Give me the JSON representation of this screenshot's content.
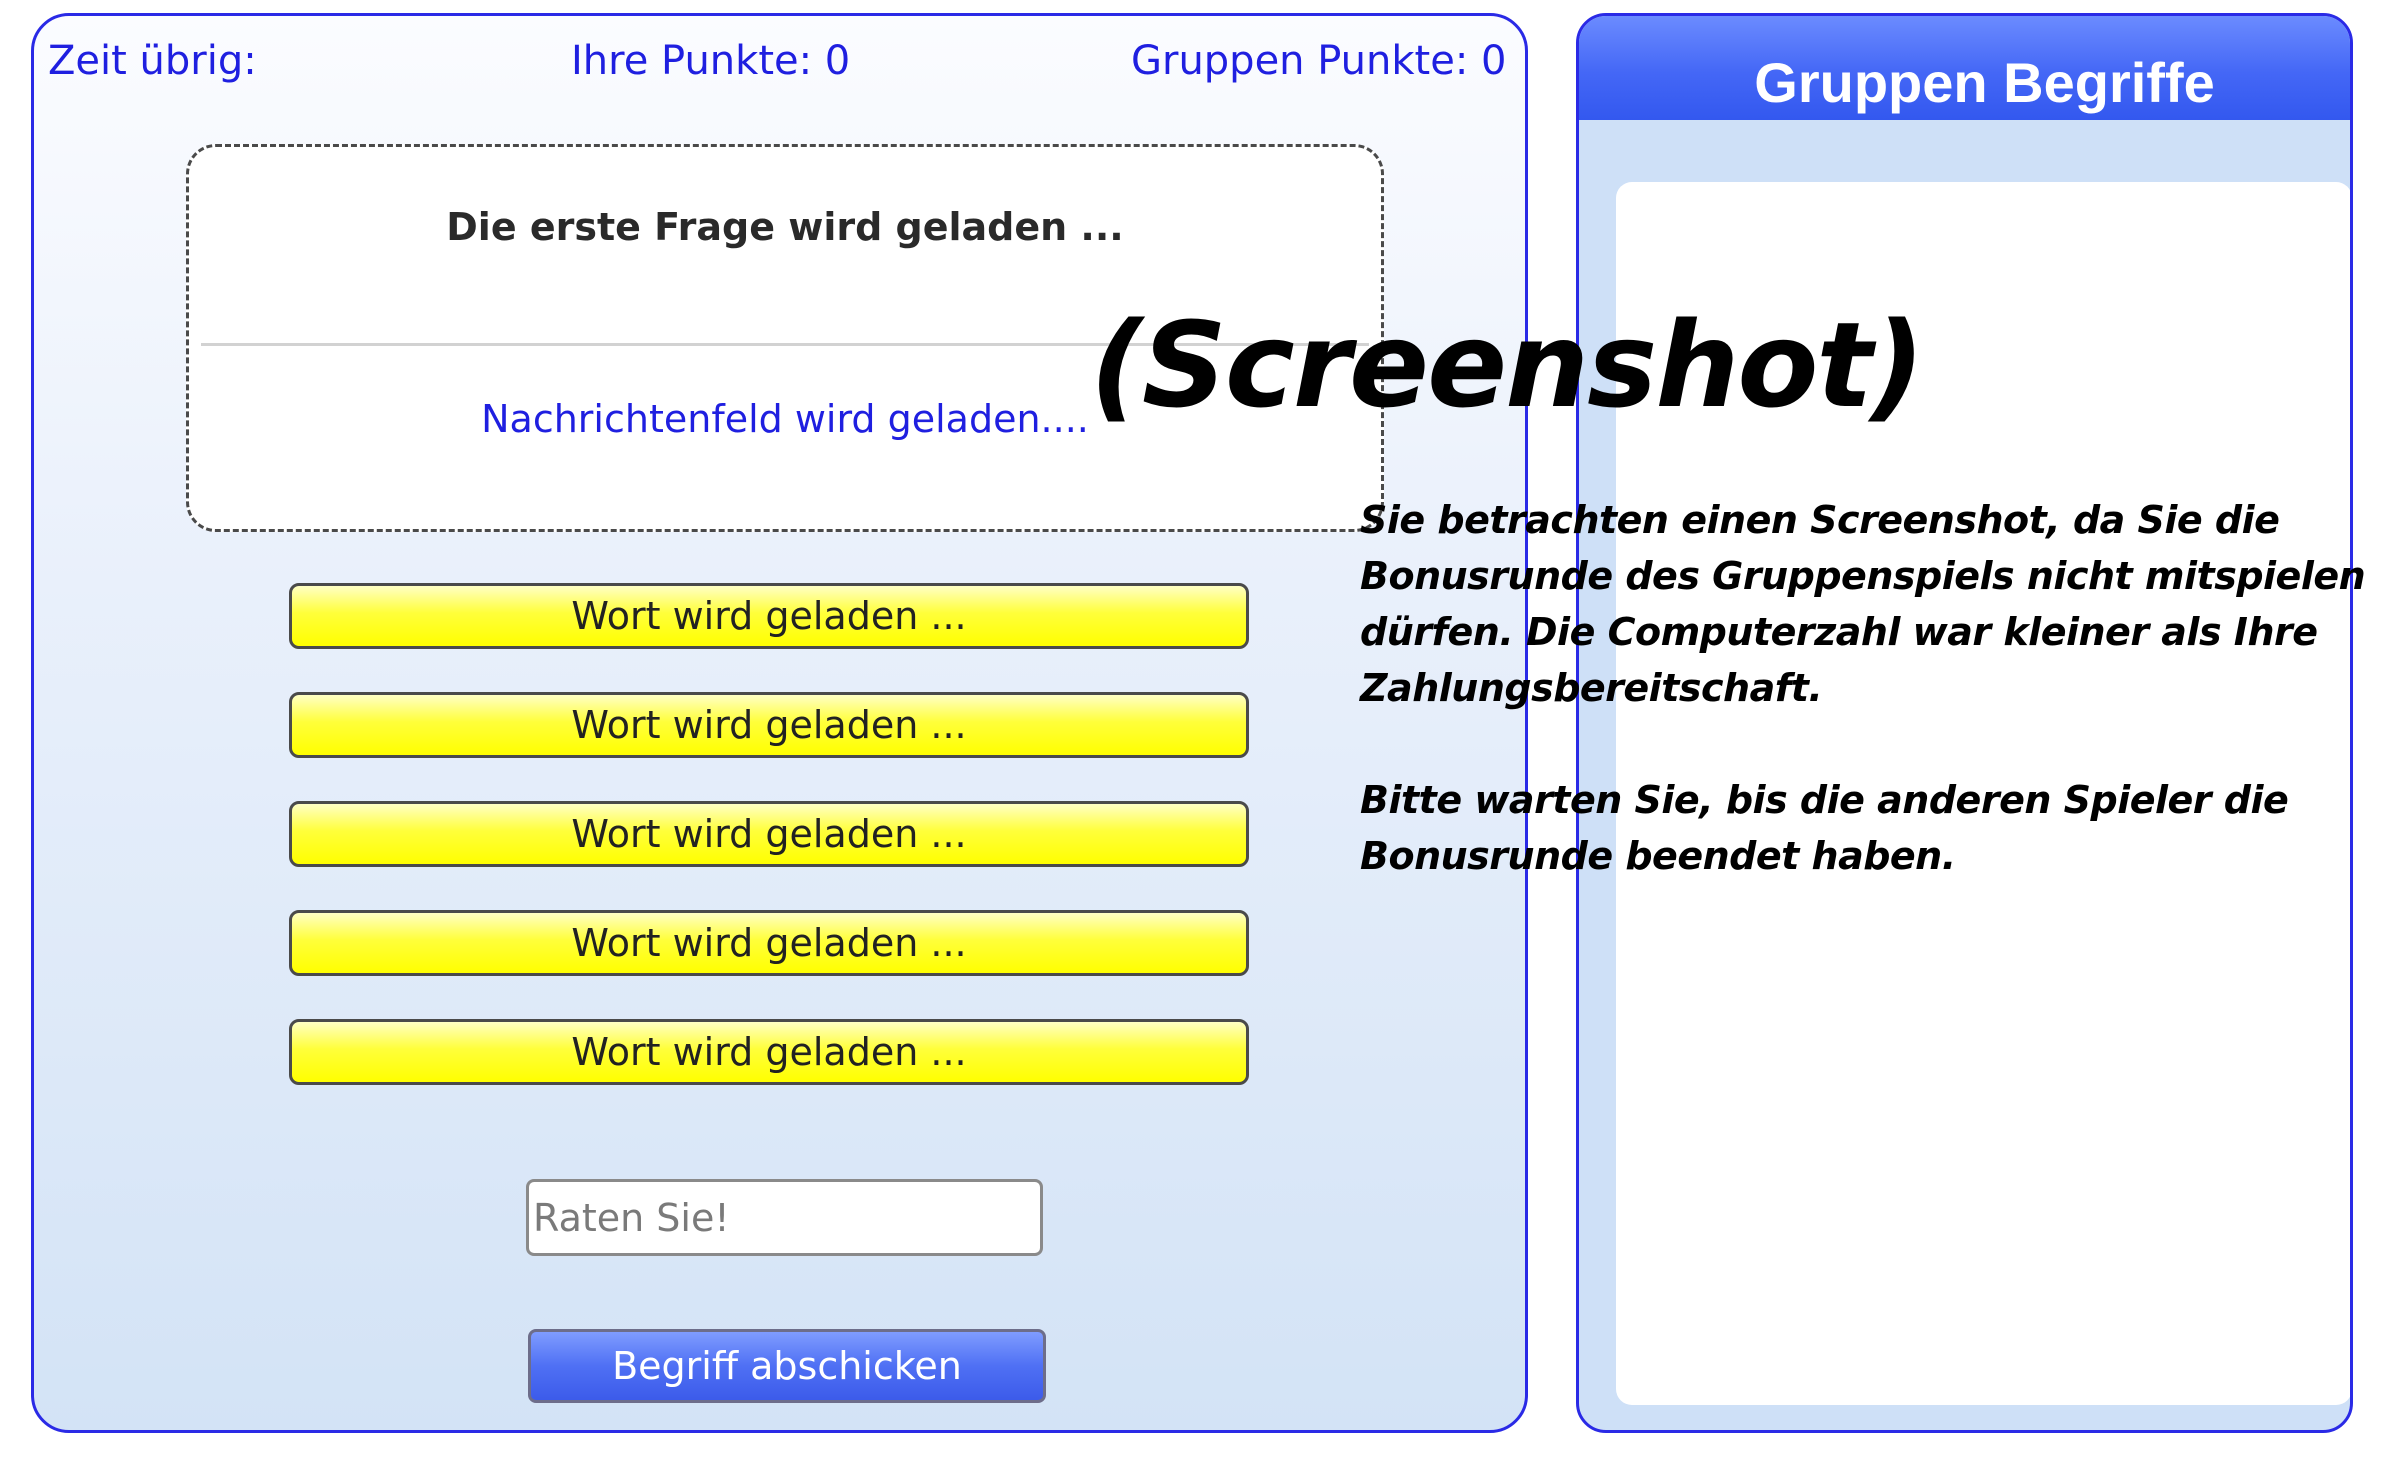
{
  "game": {
    "time_label": "Zeit übrig:",
    "own_points_label": "Ihre Punkte: 0",
    "group_points_label": "Gruppen Punkte: 0",
    "question_text": "Die erste Frage wird geladen ...",
    "message_text": "Nachrichtenfeld wird geladen....",
    "words": [
      "Wort wird geladen ...",
      "Wort wird geladen ...",
      "Wort wird geladen ...",
      "Wort wird geladen ...",
      "Wort wird geladen ..."
    ],
    "guess_placeholder": "Raten Sie!",
    "guess_value": "",
    "submit_label": "Begriff abschicken"
  },
  "terms_panel": {
    "title": "Gruppen Begriffe"
  },
  "overlay": {
    "title": "(Screenshot)",
    "paragraph_1": "Sie betrachten einen Screenshot, da Sie die Bonusrunde des Gruppenspiels nicht mitspielen dürfen. Die Computerzahl war kleiner als Ihre Zahlungsbereitschaft.",
    "paragraph_2": "Bitte warten Sie, bis die anderen Spieler die Bonusrunde beendet haben."
  },
  "colors": {
    "accent_blue": "#2a2ae6",
    "word_button_yellow": "#ffff00",
    "submit_button_blue": "#4f70f4",
    "panel_background": "#cee0f7"
  }
}
